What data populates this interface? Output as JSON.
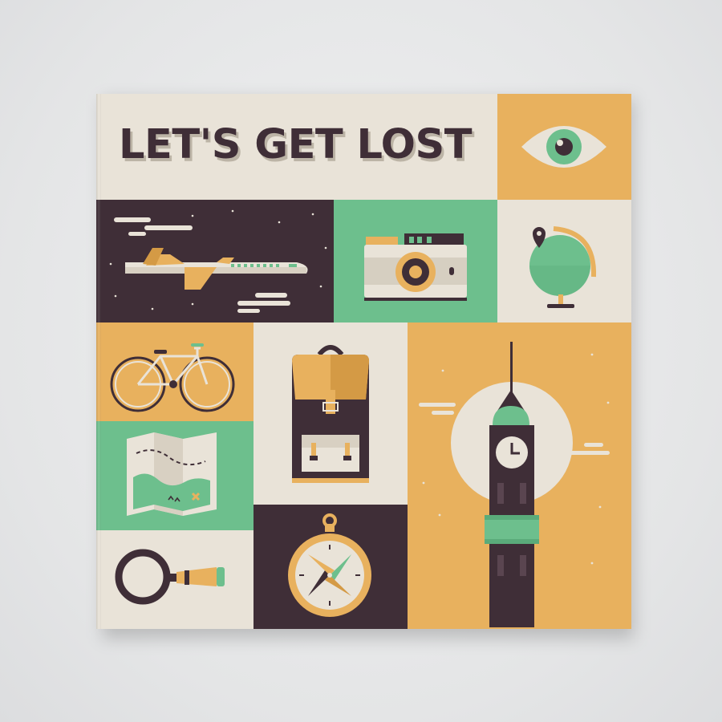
{
  "cover": {
    "title": "LET'S GET LOST"
  },
  "palette": {
    "cream": "#e9e3d8",
    "plum": "#3f2e37",
    "green": "#6dbf8d",
    "mustard": "#e8b15e",
    "background": "#e7e8e9"
  },
  "tiles": [
    {
      "icon": "eye-icon",
      "color": "mustard"
    },
    {
      "icon": "airplane-icon",
      "color": "plum"
    },
    {
      "icon": "camera-icon",
      "color": "green"
    },
    {
      "icon": "globe-icon",
      "color": "cream"
    },
    {
      "icon": "bicycle-icon",
      "color": "mustard"
    },
    {
      "icon": "backpack-icon",
      "color": "cream"
    },
    {
      "icon": "big-ben-icon",
      "color": "mustard"
    },
    {
      "icon": "map-icon",
      "color": "green"
    },
    {
      "icon": "compass-icon",
      "color": "plum"
    },
    {
      "icon": "magnifying-glass-icon",
      "color": "cream"
    }
  ]
}
